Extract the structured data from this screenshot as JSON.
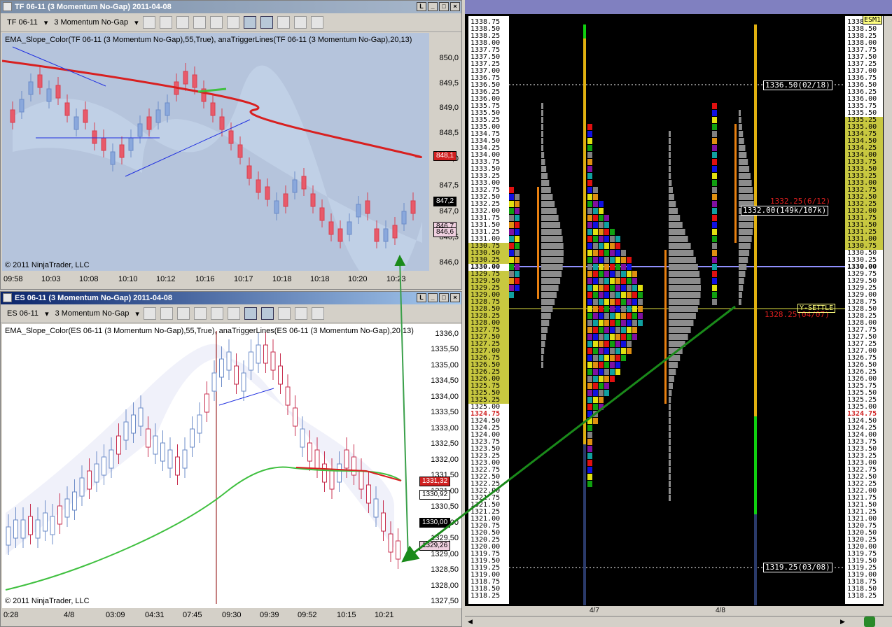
{
  "tf_window": {
    "title": "TF 06-11 (3 Momentum No-Gap)  2011-04-08",
    "instrument": "TF 06-11",
    "period": "3 Momentum No-Gap",
    "indicator_label": "EMA_Slope_Color(TF 06-11 (3 Momentum No-Gap),55,True), anaTriggerLines(TF 06-11 (3 Momentum No-Gap),20,13)",
    "copyright": "© 2011 NinjaTrader, LLC",
    "y_ticks": [
      "850,0",
      "849,5",
      "849,0",
      "848,5",
      "848,0",
      "847,5",
      "847,0",
      "846,5",
      "846,0"
    ],
    "x_ticks": [
      "09:58",
      "10:03",
      "10:08",
      "10:10",
      "10:12",
      "10:16",
      "10:17",
      "10:18",
      "10:18",
      "10:20",
      "10:23"
    ],
    "price_tags": {
      "red": "848,1",
      "black": "847,2",
      "pink": "846,7",
      "pink2": "846,6"
    }
  },
  "es_window": {
    "title": "ES 06-11 (3 Momentum No-Gap)  2011-04-08",
    "instrument": "ES 06-11",
    "period": "3 Momentum No-Gap",
    "indicator_label": "EMA_Slope_Color(ES 06-11 (3 Momentum No-Gap),55,True), anaTriggerLines(ES 06-11 (3 Momentum No-Gap),20,13)",
    "copyright": "© 2011 NinjaTrader, LLC",
    "y_ticks": [
      "1336,0",
      "1335,50",
      "1335,00",
      "1334,50",
      "1334,00",
      "1333,50",
      "1333,00",
      "1332,50",
      "1332,00",
      "1331,50",
      "1331,00",
      "1330,50",
      "1330,00",
      "1329,50",
      "1329,00",
      "1328,50",
      "1328,00",
      "1327,50"
    ],
    "x_ticks": [
      "0:28",
      "4/8",
      "03:09",
      "04:31",
      "07:45",
      "09:30",
      "09:39",
      "09:52",
      "10:15",
      "10:21"
    ],
    "price_tags": {
      "red": "1331,32",
      "white": "1330,92",
      "black": "1330,00",
      "pink": "1329,26"
    }
  },
  "market_profile": {
    "symbol": "ESM1",
    "prices": [
      "1338.75",
      "1338.50",
      "1338.25",
      "1338.00",
      "1337.75",
      "1337.50",
      "1337.25",
      "1337.00",
      "1336.75",
      "1336.50",
      "1336.25",
      "1336.00",
      "1335.75",
      "1335.50",
      "1335.25",
      "1335.00",
      "1334.75",
      "1334.50",
      "1334.25",
      "1334.00",
      "1333.75",
      "1333.50",
      "1333.25",
      "1333.00",
      "1332.75",
      "1332.50",
      "1332.25",
      "1332.00",
      "1331.75",
      "1331.50",
      "1331.25",
      "1331.00",
      "1330.75",
      "1330.50",
      "1330.25",
      "1330.00",
      "1329.75",
      "1329.50",
      "1329.25",
      "1329.00",
      "1328.75",
      "1328.50",
      "1328.25",
      "1328.00",
      "1327.75",
      "1327.50",
      "1327.25",
      "1327.00",
      "1326.75",
      "1326.50",
      "1326.25",
      "1326.00",
      "1325.75",
      "1325.50",
      "1325.25",
      "1325.00",
      "1324.75",
      "1324.50",
      "1324.25",
      "1324.00",
      "1323.75",
      "1323.50",
      "1323.25",
      "1323.00",
      "1322.75",
      "1322.50",
      "1322.25",
      "1322.00",
      "1321.75",
      "1321.50",
      "1321.25",
      "1321.00",
      "1320.75",
      "1320.50",
      "1320.25",
      "1320.00",
      "1319.75",
      "1319.50",
      "1319.25",
      "1319.00",
      "1318.75",
      "1318.50",
      "1318.25"
    ],
    "current_price": "1330.00",
    "red_price": "1324.75",
    "labels": {
      "high_ref": "1336.50(02/18)",
      "low_ref": "1319.25(03/08)",
      "poc_ref": "1332.00(149k/107k)",
      "red_ref1": "1332.25(6/12)",
      "red_ref2": "1328.25(04/07)",
      "settle": "Y-SETTLE"
    },
    "dates": [
      "4/7",
      "4/8"
    ]
  }
}
